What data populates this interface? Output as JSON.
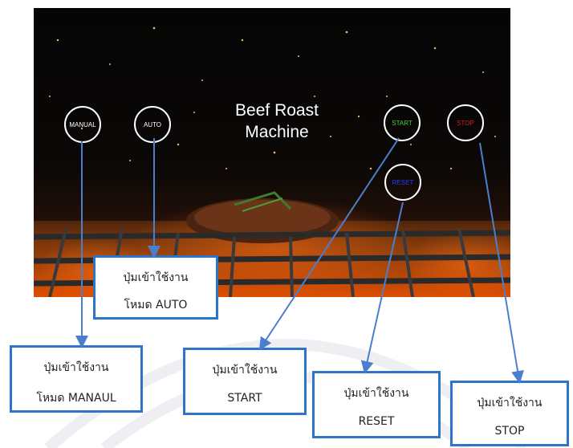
{
  "screen": {
    "title_line1": "Beef Roast",
    "title_line2": "Machine",
    "buttons": {
      "manual": "MANUAL",
      "auto": "AUTO",
      "start": "START",
      "stop": "STOP",
      "reset": "RESET"
    }
  },
  "callouts": {
    "auto": {
      "line1": "ปุ่มเข้าใช้งาน",
      "line2": "โหมด AUTO"
    },
    "manual": {
      "line1": "ปุ่มเข้าใช้งาน",
      "line2": "โหมด MANAUL"
    },
    "start": {
      "line1": "ปุ่มเข้าใช้งาน",
      "line2": "START"
    },
    "reset": {
      "line1": "ปุ่มเข้าใช้งาน",
      "line2": "RESET"
    },
    "stop": {
      "line1": "ปุ่มเข้าใช้งาน",
      "line2": "STOP"
    }
  },
  "colors": {
    "start_text": "#3cd23c",
    "stop_text": "#d42020",
    "reset_text": "#2a3cff",
    "callout_border": "#2e74c9",
    "arrow": "#4a7fd0"
  }
}
